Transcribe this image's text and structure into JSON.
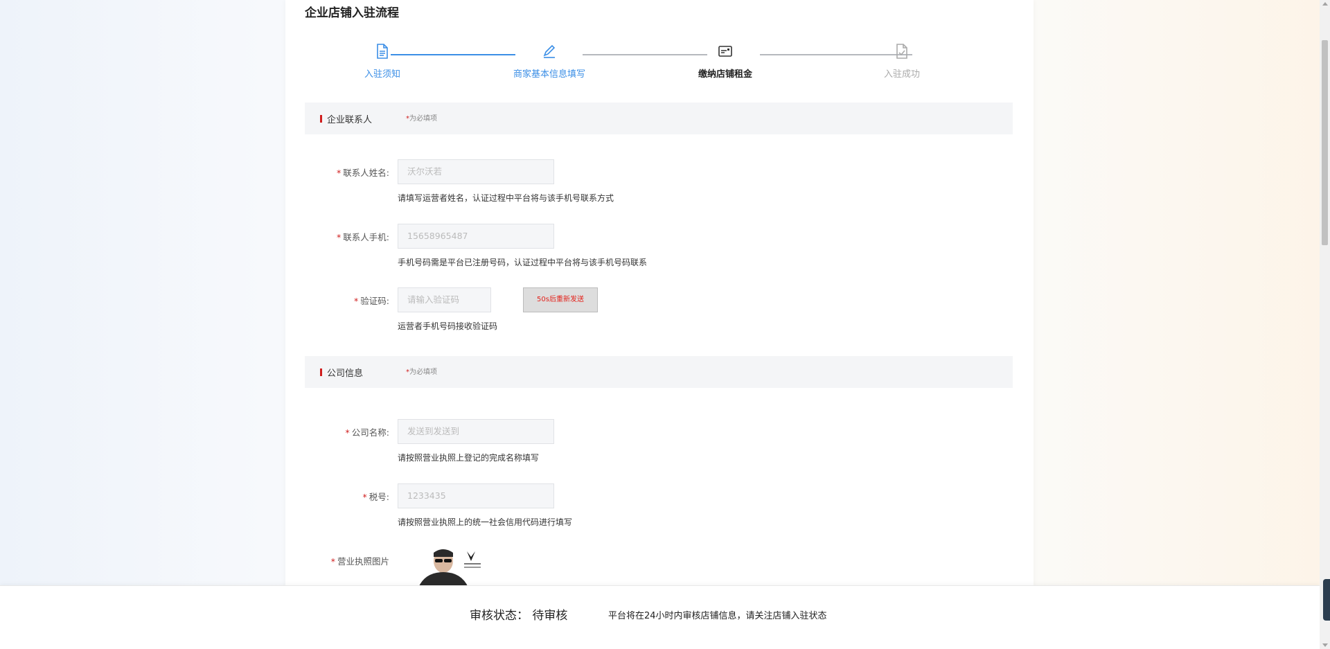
{
  "page": {
    "title": "企业店铺入驻流程"
  },
  "steps": [
    {
      "label": "入驻须知",
      "state": "done",
      "icon": "document-icon"
    },
    {
      "label": "商家基本信息填写",
      "state": "done",
      "icon": "pen-icon"
    },
    {
      "label": "缴纳店铺租金",
      "state": "current",
      "icon": "card-icon"
    },
    {
      "label": "入驻成功",
      "state": "todo",
      "icon": "document-check-icon"
    }
  ],
  "contact_section": {
    "title": "企业联系人",
    "required_star": "*",
    "required_note": "为必填项",
    "fields": [
      {
        "star": "*",
        "label": "联系人姓名:",
        "value": "沃尔沃若",
        "hint": "请填写运营者姓名，认证过程中平台将与该手机号联系方式"
      },
      {
        "star": "*",
        "label": "联系人手机:",
        "value": "15658965487",
        "hint": "手机号码需是平台已注册号码，认证过程中平台将与该手机号码联系"
      },
      {
        "star": "*",
        "label": "验证码:",
        "placeholder": "请输入验证码",
        "hint": "运营者手机号码接收验证码",
        "button": "50s后重新发送"
      }
    ]
  },
  "company_section": {
    "title": "公司信息",
    "required_star": "*",
    "required_note": "为必填项",
    "fields": [
      {
        "star": "*",
        "label": "公司名称:",
        "value": "发送到发送到",
        "hint": "请按照营业执照上登记的完成名称填写"
      },
      {
        "star": "*",
        "label": "税号:",
        "value": "1233435",
        "hint": "请按照营业执照上的统一社会信用代码进行填写"
      },
      {
        "star": "*",
        "label": "营业执照图片"
      }
    ]
  },
  "footer": {
    "status": "审核状态： 待审核",
    "note": "平台将在24小时内审核店铺信息，请关注店铺入驻状态"
  },
  "colors": {
    "accent": "#3a8ee6",
    "required": "#d01e1e",
    "send_text": "#e3231c"
  }
}
